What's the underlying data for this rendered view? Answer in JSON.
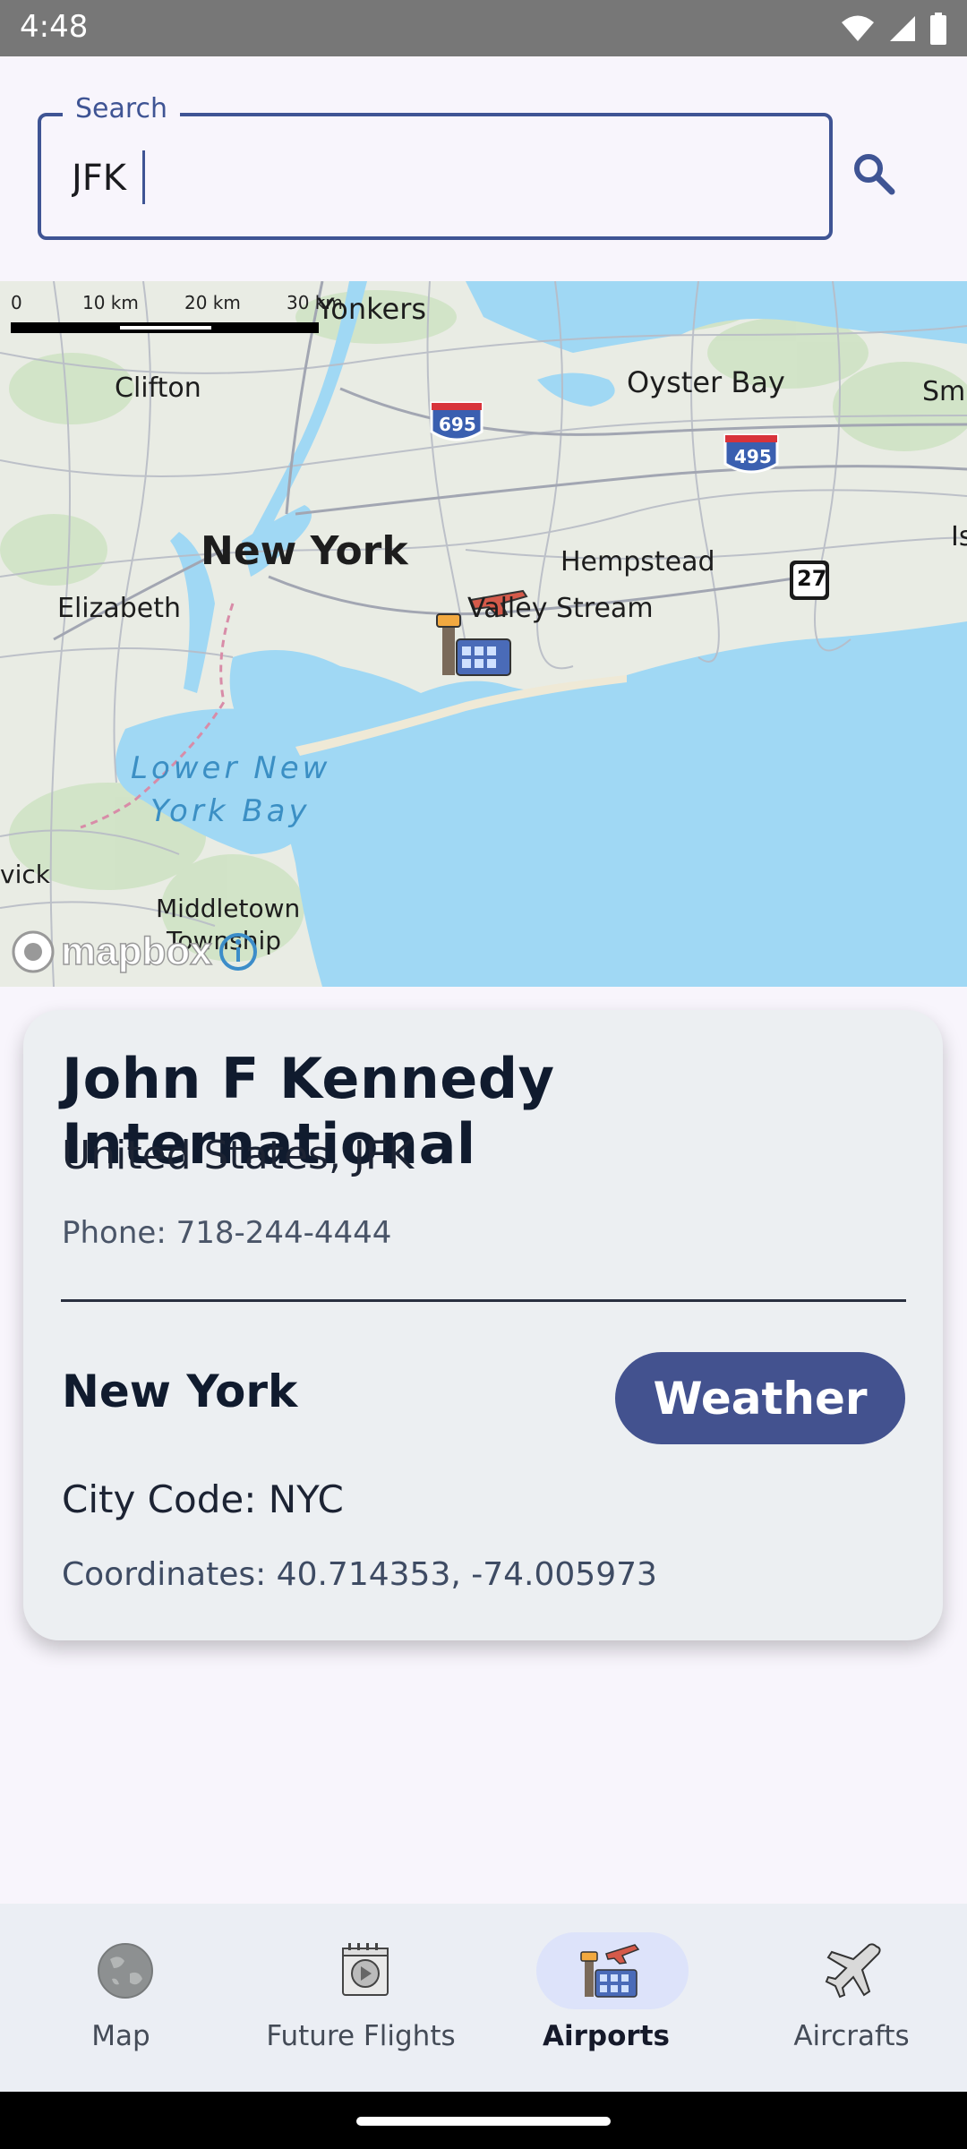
{
  "status_bar": {
    "time": "4:48"
  },
  "search": {
    "label": "Search",
    "value": "JFK"
  },
  "map": {
    "scale_labels": [
      "0",
      "10 km",
      "20 km",
      "30 km"
    ],
    "labels": {
      "yonkers": "Yonkers",
      "clifton": "Clifton",
      "oyster_bay": "Oyster Bay",
      "smi": "Smi",
      "new_york": "New York",
      "hempstead": "Hempstead",
      "elizabeth": "Elizabeth",
      "valley_stream": "Valley Stream",
      "lower_new_york_bay_1": "Lower New",
      "lower_new_york_bay_2": "York Bay",
      "vick": "vick",
      "middletown_1": "Middletown",
      "middletown_2": "Township",
      "is": "Is",
      "route_695": "695",
      "route_495": "495",
      "route_27": "27"
    },
    "attribution": "mapbox"
  },
  "airport": {
    "name": "John F Kennedy International",
    "country_code": "United States, JFK",
    "phone": "Phone: 718-244-4444",
    "city": "New York",
    "weather_button": "Weather",
    "city_code": "City Code: NYC",
    "coordinates": "Coordinates: 40.714353, -74.005973"
  },
  "nav": {
    "items": [
      {
        "label": "Map",
        "icon": "globe-icon",
        "active": false
      },
      {
        "label": "Future Flights",
        "icon": "flight-board-icon",
        "active": false
      },
      {
        "label": "Airports",
        "icon": "airport-icon",
        "active": true
      },
      {
        "label": "Aircrafts",
        "icon": "airplane-icon",
        "active": false
      }
    ]
  },
  "colors": {
    "accent": "#3f5494",
    "weather_button": "#43528f",
    "card_bg": "#eceff2",
    "water": "#a0d8f4",
    "land": "#e9ece4"
  }
}
